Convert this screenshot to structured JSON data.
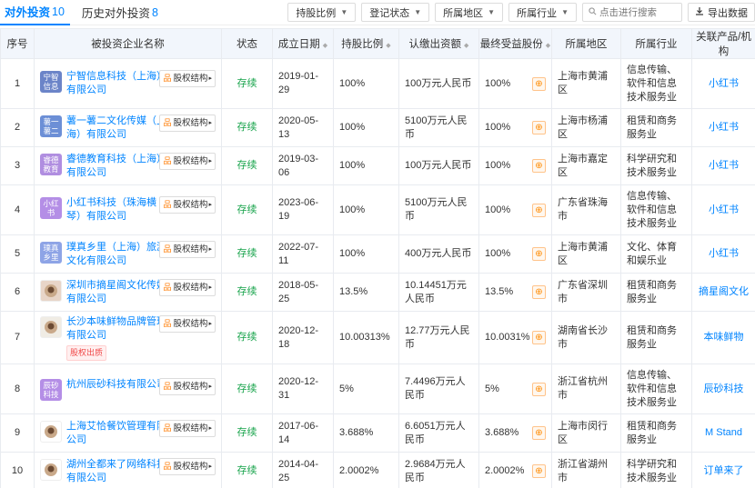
{
  "tabs": [
    {
      "label": "对外投资",
      "count": "10"
    },
    {
      "label": "历史对外投资",
      "count": "8"
    }
  ],
  "filters": {
    "holding_ratio": "持股比例",
    "reg_status": "登记状态",
    "region": "所属地区",
    "industry": "所属行业",
    "search_placeholder": "点击进行搜索",
    "export": "导出数据"
  },
  "columns": [
    "序号",
    "被投资企业名称",
    "状态",
    "成立日期",
    "持股比例",
    "认缴出资额",
    "最终受益股份",
    "所属地区",
    "所属行业",
    "关联产品/机构"
  ],
  "equity_label": "股权结构",
  "rows": [
    {
      "no": "1",
      "logo": "宁智信息",
      "logo_color": "#6b84c8",
      "name": "宁智信息科技（上海）有限公司",
      "status": "存续",
      "date": "2019-01-29",
      "ratio": "100%",
      "capital": "100万元人民币",
      "benefit": "100%",
      "region": "上海市黄浦区",
      "industry": "信息传输、软件和信息技术服务业",
      "product": "小红书",
      "pledge": ""
    },
    {
      "no": "2",
      "logo": "薯一薯二",
      "logo_color": "#6c8fd6",
      "name": "薯一薯二文化传媒（上海）有限公司",
      "status": "存续",
      "date": "2020-05-13",
      "ratio": "100%",
      "capital": "5100万元人民币",
      "benefit": "100%",
      "region": "上海市杨浦区",
      "industry": "租赁和商务服务业",
      "product": "小红书",
      "pledge": ""
    },
    {
      "no": "3",
      "logo": "睿德教育",
      "logo_color": "#b08ee0",
      "name": "睿德教育科技（上海）有限公司",
      "status": "存续",
      "date": "2019-03-06",
      "ratio": "100%",
      "capital": "100万元人民币",
      "benefit": "100%",
      "region": "上海市嘉定区",
      "industry": "科学研究和技术服务业",
      "product": "小红书",
      "pledge": ""
    },
    {
      "no": "4",
      "logo": "小红书",
      "logo_color": "#b48ee6",
      "name": "小红书科技（珠海横琴）有限公司",
      "status": "存续",
      "date": "2023-06-19",
      "ratio": "100%",
      "capital": "5100万元人民币",
      "benefit": "100%",
      "region": "广东省珠海市",
      "industry": "信息传输、软件和信息技术服务业",
      "product": "小红书",
      "pledge": ""
    },
    {
      "no": "5",
      "logo": "璞真乡里",
      "logo_color": "#8ea4e6",
      "name": "璞真乡里（上海）旅游文化有限公司",
      "status": "存续",
      "date": "2022-07-11",
      "ratio": "100%",
      "capital": "400万元人民币",
      "benefit": "100%",
      "region": "上海市黄浦区",
      "industry": "文化、体育和娱乐业",
      "product": "小红书",
      "pledge": ""
    },
    {
      "no": "6",
      "logo": "",
      "logo_color": "#e8d5c8",
      "name": "深圳市摘星阁文化传媒有限公司",
      "status": "存续",
      "date": "2018-05-25",
      "ratio": "13.5%",
      "capital": "10.14451万元人民币",
      "benefit": "13.5%",
      "region": "广东省深圳市",
      "industry": "租赁和商务服务业",
      "product": "摘星阁文化",
      "pledge": ""
    },
    {
      "no": "7",
      "logo": "",
      "logo_color": "#f0ece4",
      "name": "长沙本味鲜物品牌管理有限公司",
      "status": "存续",
      "date": "2020-12-18",
      "ratio": "10.00313%",
      "capital": "12.77万元人民币",
      "benefit": "10.0031%",
      "region": "湖南省长沙市",
      "industry": "租赁和商务服务业",
      "product": "本味鲜物",
      "pledge": "股权出质"
    },
    {
      "no": "8",
      "logo": "辰砂科技",
      "logo_color": "#b48ee6",
      "name": "杭州辰砂科技有限公司",
      "status": "存续",
      "date": "2020-12-31",
      "ratio": "5%",
      "capital": "7.4496万元人民币",
      "benefit": "5%",
      "region": "浙江省杭州市",
      "industry": "信息传输、软件和信息技术服务业",
      "product": "辰砂科技",
      "pledge": ""
    },
    {
      "no": "9",
      "logo": "",
      "logo_color": "#ffffff",
      "name": "上海艾恰餐饮管理有限公司",
      "status": "存续",
      "date": "2017-06-14",
      "ratio": "3.688%",
      "capital": "6.6051万元人民币",
      "benefit": "3.688%",
      "region": "上海市闵行区",
      "industry": "租赁和商务服务业",
      "product": "M Stand",
      "pledge": ""
    },
    {
      "no": "10",
      "logo": "",
      "logo_color": "#ffffff",
      "name": "湖州全都来了网络科技有限公司",
      "status": "存续",
      "date": "2014-04-25",
      "ratio": "2.0002%",
      "capital": "2.9684万元人民币",
      "benefit": "2.0002%",
      "region": "浙江省湖州市",
      "industry": "科学研究和技术服务业",
      "product": "订单来了",
      "pledge": ""
    }
  ]
}
